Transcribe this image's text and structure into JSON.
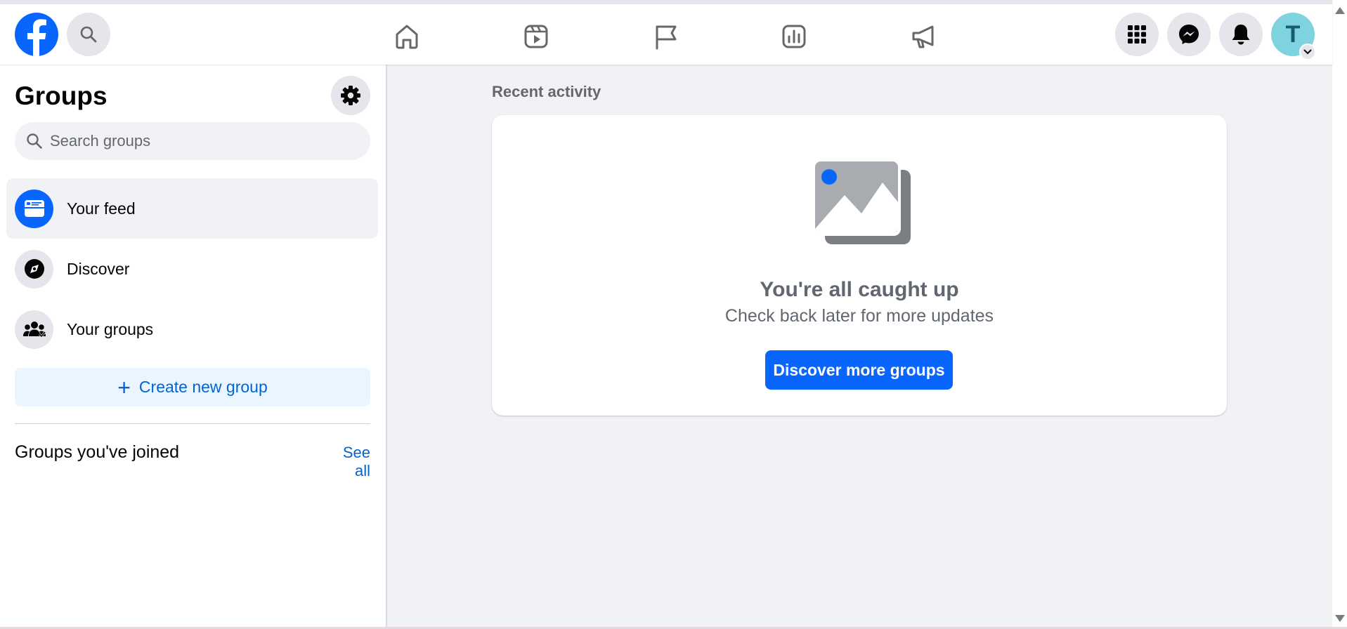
{
  "topbar": {
    "search_label": "Search Facebook",
    "avatar_initial": "T"
  },
  "sidebar": {
    "title": "Groups",
    "search_placeholder": "Search groups",
    "items": [
      {
        "label": "Your feed",
        "active": true
      },
      {
        "label": "Discover",
        "active": false
      },
      {
        "label": "Your groups",
        "active": false
      }
    ],
    "create_label": "Create new group",
    "create_icon": "+",
    "joined_title": "Groups you've joined",
    "see_all": "See all"
  },
  "main": {
    "section_label": "Recent activity",
    "empty_title": "You're all caught up",
    "empty_subtitle": "Check back later for more updates",
    "discover_label": "Discover more groups"
  },
  "colors": {
    "brand": "#0866ff",
    "link": "#0064d1",
    "background": "#f0f2f5"
  }
}
